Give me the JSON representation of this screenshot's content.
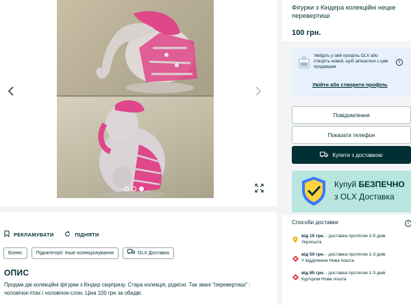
{
  "gallery": {
    "prev_icon": "chevron-left",
    "next_icon": "chevron-right",
    "expand_icon": "expand",
    "dots_count": 3,
    "active_dot": 3
  },
  "actions": {
    "promote": "РЕКЛАМУВАТИ",
    "raise": "ПІДНЯТИ"
  },
  "tags": [
    "Бізнес",
    "Підкатегорії: Інше колекціонування",
    "OLX Доставка"
  ],
  "description": {
    "title": "ОПИС",
    "text": "Продам дві колекційні фігурки з Кіндер сюрпризу. Стара колекція, рідкісні. Так звані \"перевертиші\" : чоловічок-птах і чоловічок-слон. Ціна 100 грн за обидві."
  },
  "listing": {
    "title": "Фігурки з Кіндера колекційні нецке перевертиші",
    "price": "100 грн."
  },
  "profile_box": {
    "text": "Увійдіть у свій профіль OLX або створіть новий, щоб зв'язатися з цим продавцем",
    "link": "Увійти або створити профіль"
  },
  "buttons": {
    "message": "Повідомлення",
    "show_phone": "Показати телефон",
    "buy_delivery": "Купити з доставкою"
  },
  "promo": {
    "line1_pre": "Купуй ",
    "line1_bold": "БЕЗПЕЧНО",
    "line2": "з OLX Доставка"
  },
  "delivery": {
    "title": "Способи доставки",
    "items": [
      {
        "main": "від 15 грн. - доставка протягом 2-5 днів",
        "sub": "Укрпошта",
        "color": "#f2b705"
      },
      {
        "main": "від 50 грн. - доставка протягом 1-3 днів",
        "sub": "У відділення Нова пошта",
        "color": "#d7282f"
      },
      {
        "main": "від 85 грн. - доставка протягом 1-3 днів",
        "sub": "Кур'єром Нова пошта",
        "color": "#d7282f"
      }
    ]
  },
  "colors": {
    "dark": "#002f34",
    "promo_bg": "#b8e6df",
    "profile_bg": "#e8f0fb",
    "figurine_pink": "#e0468a"
  }
}
